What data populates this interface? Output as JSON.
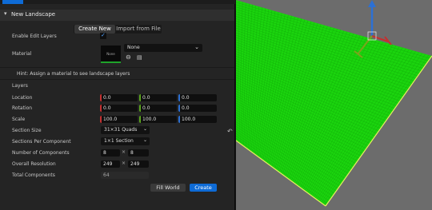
{
  "panel": {
    "section_title": "New Landscape",
    "modes": {
      "create_new": "Create New",
      "import_from_file": "Import from File",
      "selected": "Create New"
    },
    "enable_edit_layers": {
      "label": "Enable Edit Layers",
      "checked": true
    },
    "material": {
      "label": "Material",
      "thumbnail_text": "None",
      "value": "None",
      "use_icon": "use-selected-icon",
      "browse_icon": "browse-icon"
    },
    "hint": "Hint: Assign a material to see landscape layers",
    "layers_label": "Layers",
    "location": {
      "label": "Location",
      "x": "0.0",
      "y": "0.0",
      "z": "0.0"
    },
    "rotation": {
      "label": "Rotation",
      "x": "0.0",
      "y": "0.0",
      "z": "0.0"
    },
    "scale": {
      "label": "Scale",
      "x": "100.0",
      "y": "100.0",
      "z": "100.0"
    },
    "section_size": {
      "label": "Section Size",
      "value": "31×31 Quads"
    },
    "sections_per_component": {
      "label": "Sections Per Component",
      "value": "1×1 Section"
    },
    "number_of_components": {
      "label": "Number of Components",
      "x": "8",
      "y": "8"
    },
    "overall_resolution": {
      "label": "Overall Resolution",
      "x": "249",
      "y": "249"
    },
    "total_components": {
      "label": "Total Components",
      "value": "64"
    },
    "times_symbol": "×",
    "buttons": {
      "fill_world": "Fill World",
      "create": "Create"
    }
  },
  "colors": {
    "accent": "#0e6bd6",
    "landscape": "#1bd40e",
    "viewport_bg": "#6c6c6c",
    "axis_x": "#c53030",
    "axis_y": "#5aa51c",
    "axis_z": "#2c70d4"
  }
}
